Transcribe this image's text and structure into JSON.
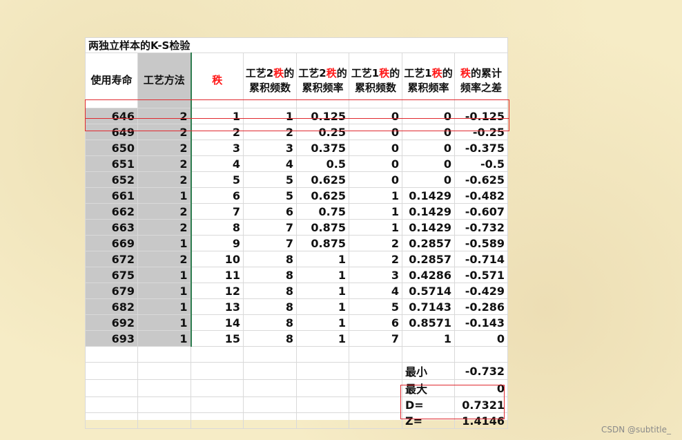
{
  "sheet": {
    "title": "两独立样本的K-S检验",
    "headers": {
      "c1": "使用寿命",
      "c2": "工艺方法",
      "c3": "秩",
      "c4_pre": "工艺2",
      "c4_red": "秩",
      "c4_post": "的累积频数",
      "c5_pre": "工艺2",
      "c5_red": "秩",
      "c5_post": "的累积频率",
      "c6_pre": "工艺1",
      "c6_red": "秩",
      "c6_post": "的累积频数",
      "c7_pre": "工艺1",
      "c7_red": "秩",
      "c7_post": "的累积频率",
      "c8_red": "秩",
      "c8_post": "的累计频率之差"
    },
    "rows": [
      [
        "646",
        "2",
        "1",
        "1",
        "0.125",
        "0",
        "0",
        "-0.125"
      ],
      [
        "649",
        "2",
        "2",
        "2",
        "0.25",
        "0",
        "0",
        "-0.25"
      ],
      [
        "650",
        "2",
        "3",
        "3",
        "0.375",
        "0",
        "0",
        "-0.375"
      ],
      [
        "651",
        "2",
        "4",
        "4",
        "0.5",
        "0",
        "0",
        "-0.5"
      ],
      [
        "652",
        "2",
        "5",
        "5",
        "0.625",
        "0",
        "0",
        "-0.625"
      ],
      [
        "661",
        "1",
        "6",
        "5",
        "0.625",
        "1",
        "0.1429",
        "-0.482"
      ],
      [
        "662",
        "2",
        "7",
        "6",
        "0.75",
        "1",
        "0.1429",
        "-0.607"
      ],
      [
        "663",
        "2",
        "8",
        "7",
        "0.875",
        "1",
        "0.1429",
        "-0.732"
      ],
      [
        "669",
        "1",
        "9",
        "7",
        "0.875",
        "2",
        "0.2857",
        "-0.589"
      ],
      [
        "672",
        "2",
        "10",
        "8",
        "1",
        "2",
        "0.2857",
        "-0.714"
      ],
      [
        "675",
        "1",
        "11",
        "8",
        "1",
        "3",
        "0.4286",
        "-0.571"
      ],
      [
        "679",
        "1",
        "12",
        "8",
        "1",
        "4",
        "0.5714",
        "-0.429"
      ],
      [
        "682",
        "1",
        "13",
        "8",
        "1",
        "5",
        "0.7143",
        "-0.286"
      ],
      [
        "692",
        "1",
        "14",
        "8",
        "1",
        "6",
        "0.8571",
        "-0.143"
      ],
      [
        "693",
        "1",
        "15",
        "8",
        "1",
        "7",
        "1",
        "0"
      ]
    ],
    "summary": [
      {
        "label": "最小",
        "value": "-0.732"
      },
      {
        "label": "最大",
        "value": "0"
      },
      {
        "label": "D=",
        "value": "0.7321"
      },
      {
        "label": "Z=",
        "value": "1.4146"
      }
    ]
  },
  "watermark": "CSDN @subtitle_",
  "colors": {
    "highlight_red": "#e0282e",
    "selection_green": "#2e7d4f",
    "header_red": "#ff1a1a",
    "column_gray": "#c8c8c8"
  }
}
